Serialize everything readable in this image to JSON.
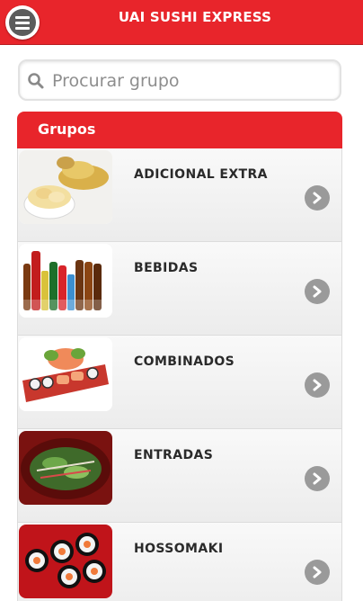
{
  "header": {
    "title": "UAI SUSHI EXPRESS",
    "menu_icon": "hamburger-menu-icon"
  },
  "search": {
    "placeholder": "Procurar grupo",
    "value": ""
  },
  "groups": {
    "title": "Grupos",
    "items": [
      {
        "label": "ADICIONAL EXTRA",
        "image": "ginger-bowl-image"
      },
      {
        "label": "BEBIDAS",
        "image": "drink-bottles-image"
      },
      {
        "label": "COMBINADOS",
        "image": "sushi-platter-image"
      },
      {
        "label": "ENTRADAS",
        "image": "salad-plate-image"
      },
      {
        "label": "HOSSOMAKI",
        "image": "hossomaki-image"
      }
    ]
  },
  "colors": {
    "brand_red": "#e8252b",
    "arrow_gray": "#9a9a9a"
  }
}
